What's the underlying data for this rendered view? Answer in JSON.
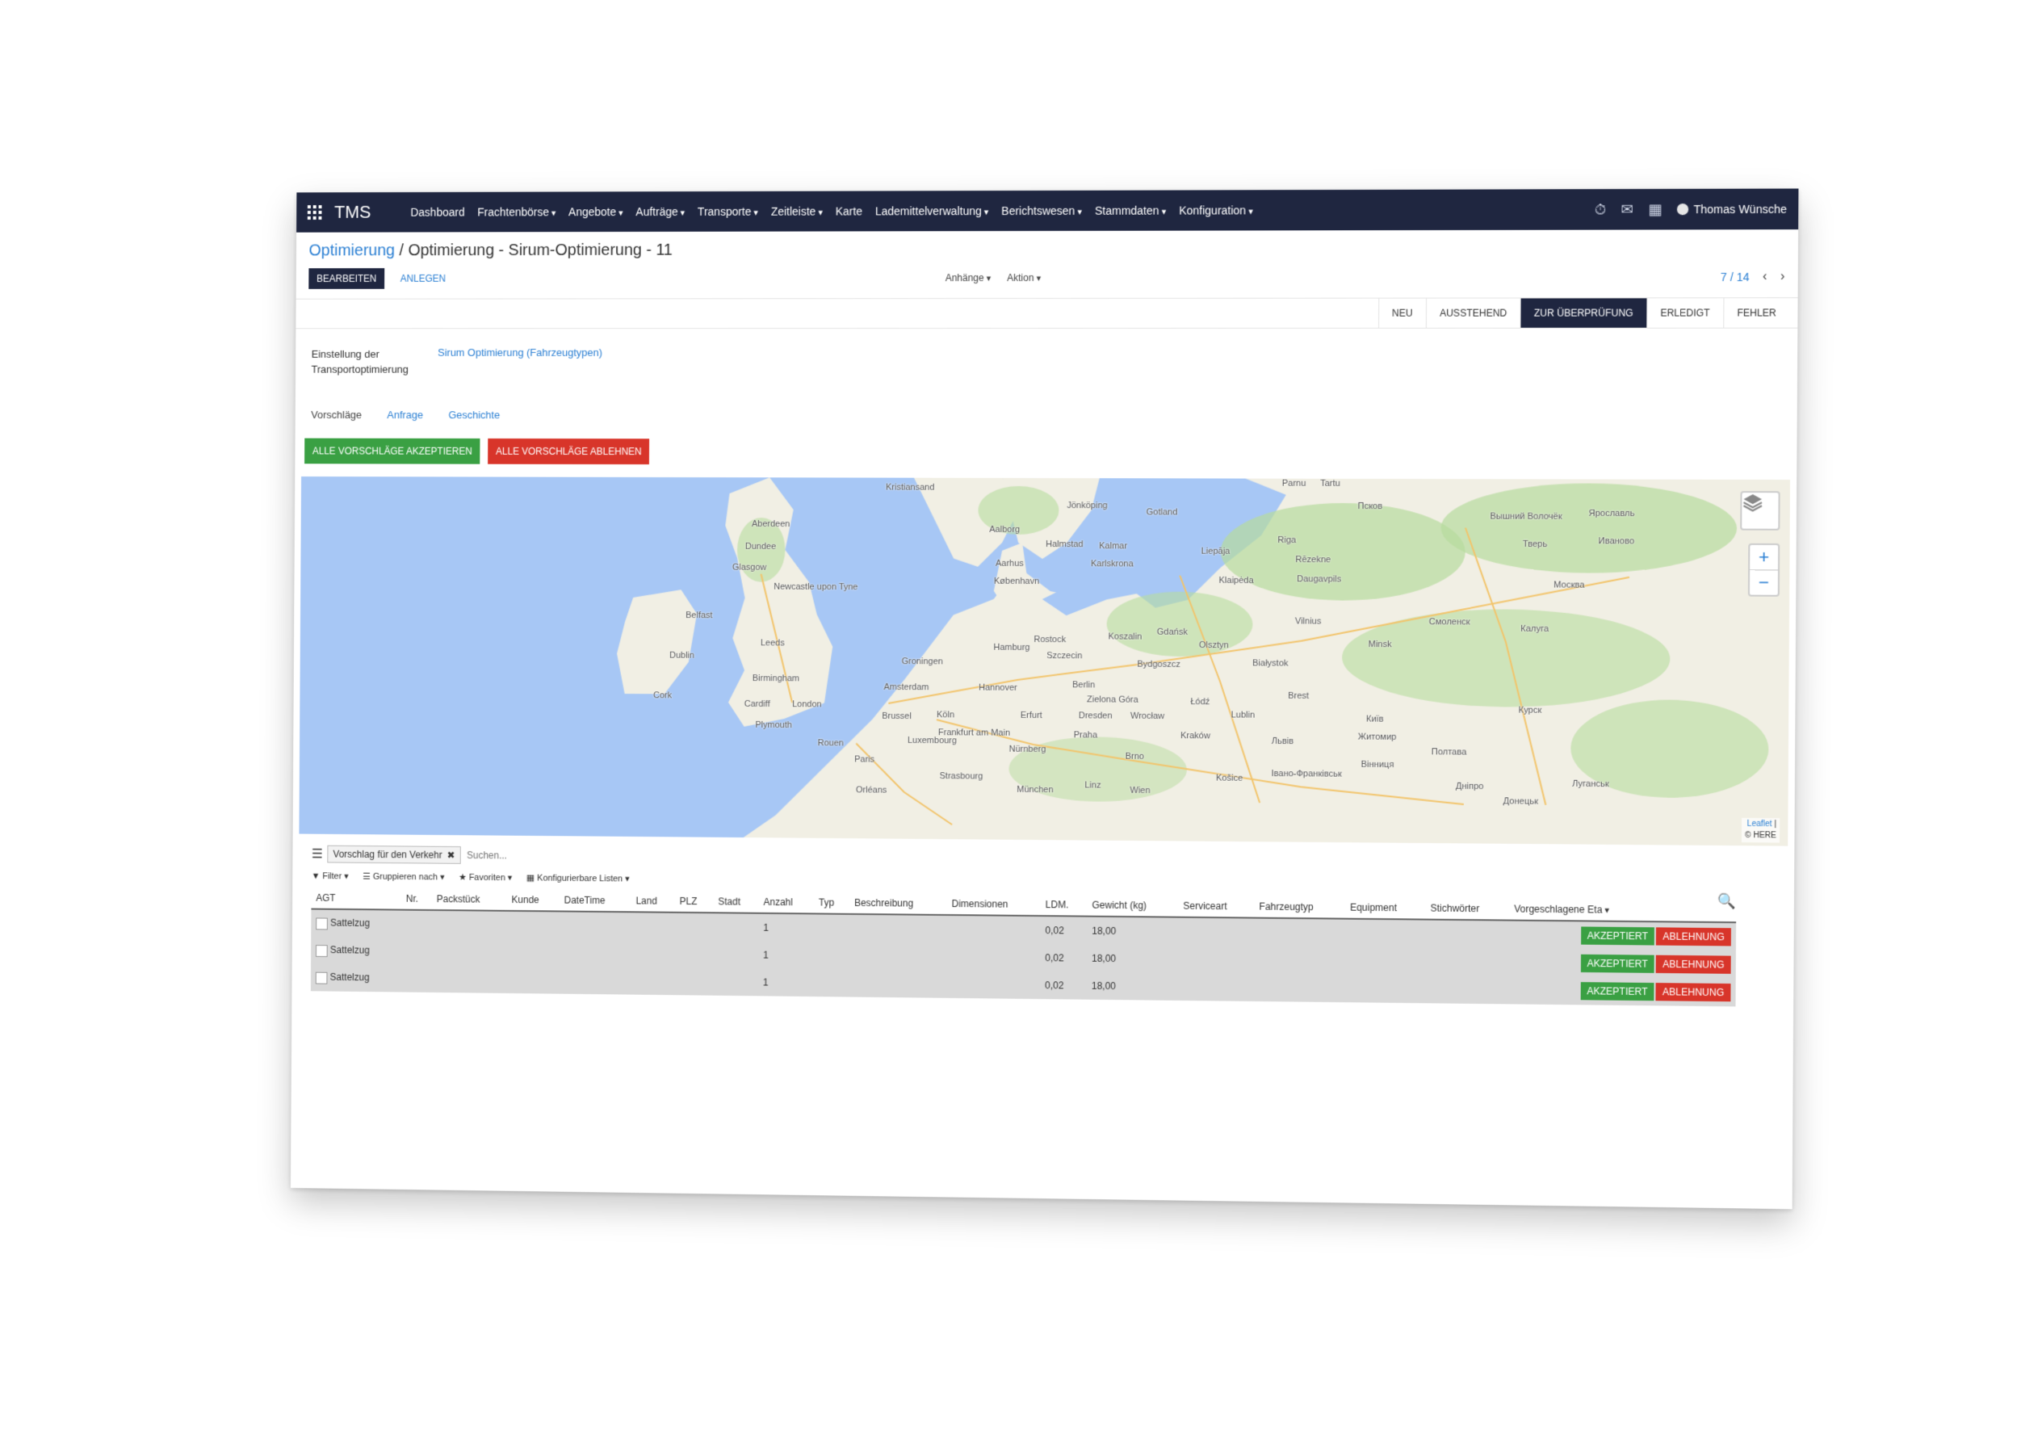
{
  "navbar": {
    "brand": "TMS",
    "menu": [
      {
        "label": "Dashboard",
        "dropdown": false
      },
      {
        "label": "Frachtenbörse",
        "dropdown": true
      },
      {
        "label": "Angebote",
        "dropdown": true
      },
      {
        "label": "Aufträge",
        "dropdown": true
      },
      {
        "label": "Transporte",
        "dropdown": true
      },
      {
        "label": "Zeitleiste",
        "dropdown": true
      },
      {
        "label": "Karte",
        "dropdown": false
      },
      {
        "label": "Lademittelverwaltung",
        "dropdown": true
      },
      {
        "label": "Berichtswesen",
        "dropdown": true
      },
      {
        "label": "Stammdaten",
        "dropdown": true
      },
      {
        "label": "Konfiguration",
        "dropdown": true
      }
    ],
    "user": "Thomas Wünsche"
  },
  "breadcrumb": {
    "parent": "Optimierung",
    "separator": "/",
    "current": "Optimierung - Sirum-Optimierung - 11"
  },
  "controls": {
    "edit": "BEARBEITEN",
    "create": "ANLEGEN",
    "attachments": "Anhänge",
    "action": "Aktion",
    "pager": "7 / 14"
  },
  "status_stages": [
    {
      "label": "NEU",
      "active": false
    },
    {
      "label": "AUSSTEHEND",
      "active": false
    },
    {
      "label": "ZUR ÜBERPRÜFUNG",
      "active": true
    },
    {
      "label": "ERLEDIGT",
      "active": false
    },
    {
      "label": "FEHLER",
      "active": false
    }
  ],
  "form": {
    "setting_label": "Einstellung der Transportoptimierung",
    "setting_value": "Sirum Optimierung (Fahrzeugtypen)"
  },
  "tabs": [
    {
      "label": "Vorschläge",
      "active": true
    },
    {
      "label": "Anfrage",
      "active": false
    },
    {
      "label": "Geschichte",
      "active": false
    }
  ],
  "actions": {
    "accept_all": "ALLE VORSCHLÄGE AKZEPTIEREN",
    "reject_all": "ALLE VORSCHLÄGE ABLEHNEN"
  },
  "map": {
    "attribution_link": "Leaflet",
    "attribution_text": "© HERE",
    "zoom_in": "+",
    "zoom_out": "−",
    "colors": {
      "water": "#a7c7f5",
      "land": "#f1efe4",
      "forest": "#b7dc9e"
    },
    "cities": [
      "Kristiansand",
      "Jönköping",
      "Gotland",
      "Parnu",
      "Tartu",
      "Aberdeen",
      "Aalborg",
      "Halmstad",
      "Kalmar",
      "Liepāja",
      "Riga",
      "Псков",
      "Dundee",
      "Glasgow",
      "Aarhus",
      "Karlskrona",
      "Klaipėda",
      "Rēzekne",
      "Newcastle upon Tyne",
      "København",
      "Daugavpils",
      "Вышний Волочёк",
      "Ярославль",
      "Тверь",
      "Иваново",
      "Москва",
      "Belfast",
      "Koszalin",
      "Gdańsk",
      "Vilnius",
      "Смоленск",
      "Калуга",
      "Dublin",
      "Leeds",
      "Groningen",
      "Hamburg",
      "Rostock",
      "Szczecin",
      "Olsztyn",
      "Minsk",
      "Bydgoszcz",
      "Białystok",
      "Cork",
      "Birmingham",
      "Amsterdam",
      "Hannover",
      "Berlin",
      "Zielona Góra",
      "Brest",
      "Cardiff",
      "London",
      "Brussel",
      "Köln",
      "Erfurt",
      "Dresden",
      "Wrocław",
      "Łódź",
      "Lublin",
      "Plymouth",
      "Luxembourg",
      "Frankfurt am Main",
      "Praha",
      "Kraków",
      "Львів",
      "Житомир",
      "Курск",
      "Rouen",
      "Paris",
      "Nürnberg",
      "Brno",
      "Київ",
      "Полтава",
      "Strasbourg",
      "München",
      "Linz",
      "Wien",
      "Košice",
      "Івано-Франківськ",
      "Orléans",
      "Вінниця",
      "Дніпро",
      "Луганськ",
      "Донецьк"
    ]
  },
  "list": {
    "facet": "Vorschlag für den Verkehr",
    "search_placeholder": "Suchen...",
    "filters": [
      "Filter",
      "Gruppieren nach",
      "Favoriten",
      "Konfigurierbare Listen"
    ],
    "columns": [
      "AGT",
      "Nr.",
      "Packstück",
      "Kunde",
      "DateTime",
      "Land",
      "PLZ",
      "Stadt",
      "Anzahl",
      "Typ",
      "Beschreibung",
      "Dimensionen",
      "LDM.",
      "Gewicht (kg)",
      "Serviceart",
      "Fahrzeugtyp",
      "Equipment",
      "Stichwörter",
      "Vorgeschlagene Eta"
    ],
    "rows": [
      {
        "agt": "Sattelzug",
        "anzahl": "1",
        "ldm": "0,02",
        "gewicht": "18,00",
        "accept": "AKZEPTIERT",
        "reject": "ABLEHNUNG"
      },
      {
        "agt": "Sattelzug",
        "anzahl": "1",
        "ldm": "0,02",
        "gewicht": "18,00",
        "accept": "AKZEPTIERT",
        "reject": "ABLEHNUNG"
      },
      {
        "agt": "Sattelzug",
        "anzahl": "1",
        "ldm": "0,02",
        "gewicht": "18,00",
        "accept": "AKZEPTIERT",
        "reject": "ABLEHNUNG"
      }
    ]
  }
}
